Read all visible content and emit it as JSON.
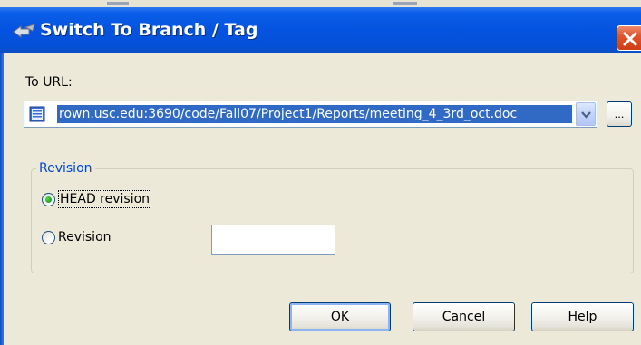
{
  "dialog": {
    "title": "Switch To Branch / Tag",
    "title_icon": "switch-branch-icon",
    "close_icon": "close-icon"
  },
  "url": {
    "label": "To URL:",
    "value": "rown.usc.edu:3690/code/Fall07/Project1/Reports/meeting_4_3rd_oct.doc",
    "file_icon": "document-icon",
    "dropdown_icon": "chevron-down-icon",
    "browse_label": "..."
  },
  "revision": {
    "group_label": "Revision",
    "head_label": "HEAD revision",
    "specific_label": "Revision",
    "specific_value": "",
    "selected": "head"
  },
  "buttons": {
    "ok": "OK",
    "cancel": "Cancel",
    "help": "Help"
  },
  "colors": {
    "titlebar": "#0553e0",
    "dialog_bg": "#ece9d8",
    "selection": "#316ac5",
    "group_label": "#0046d5",
    "close": "#e0562e"
  }
}
